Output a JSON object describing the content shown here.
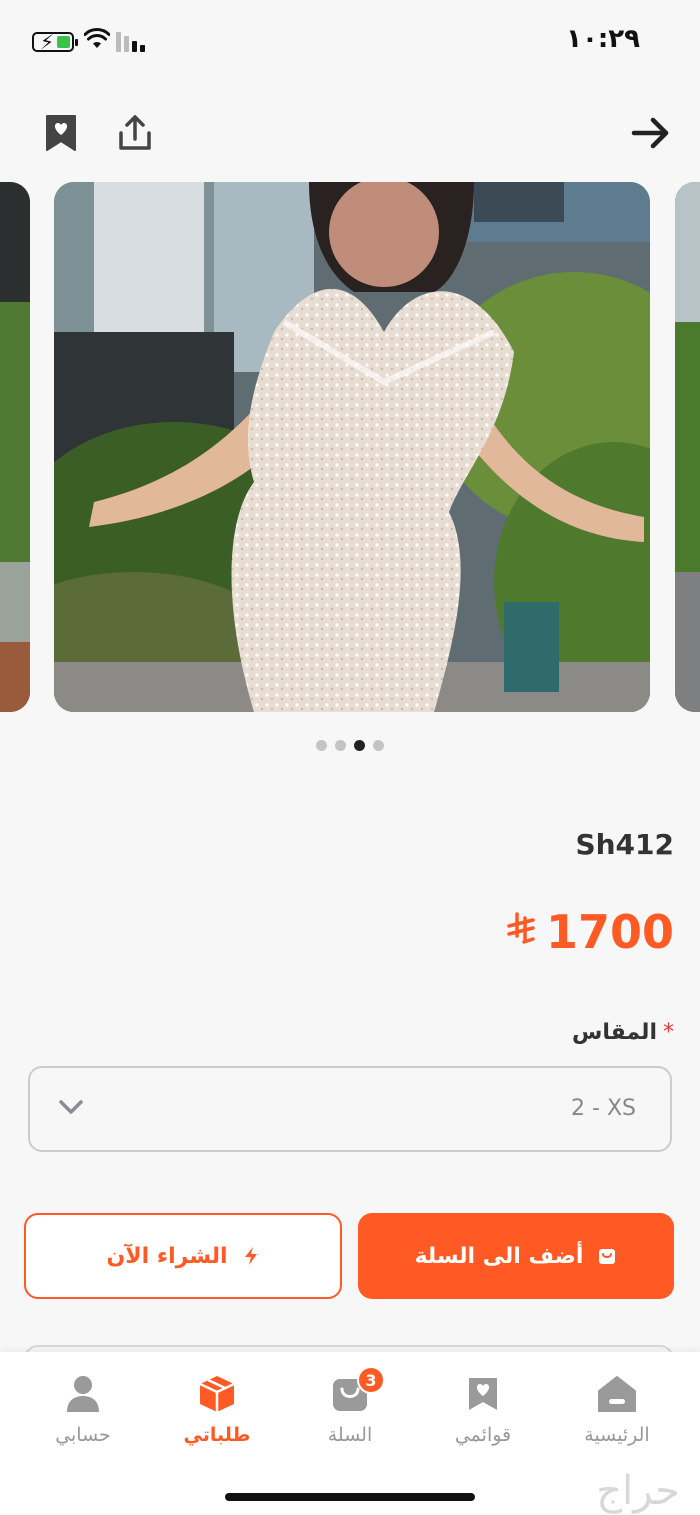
{
  "status_bar": {
    "time": "١٠:٢٩"
  },
  "product": {
    "code": "Sh412",
    "price": "1700",
    "currency_icon": "riyal-icon",
    "images_count": 4,
    "active_image_index": 2
  },
  "size": {
    "label": "المقاس",
    "required_mark": "*",
    "selected": "2 - XS"
  },
  "actions": {
    "add_to_cart": "أضف الى السلة",
    "buy_now": "الشراء الآن"
  },
  "tabs": {
    "home": "الرئيسية",
    "lists": "قوائمي",
    "cart": "السلة",
    "cart_badge": "3",
    "orders": "طلباتي",
    "account": "حسابي",
    "active": "orders"
  },
  "watermark": "حراج",
  "colors": {
    "accent": "#ff5a24",
    "background": "#f7f7f7"
  }
}
